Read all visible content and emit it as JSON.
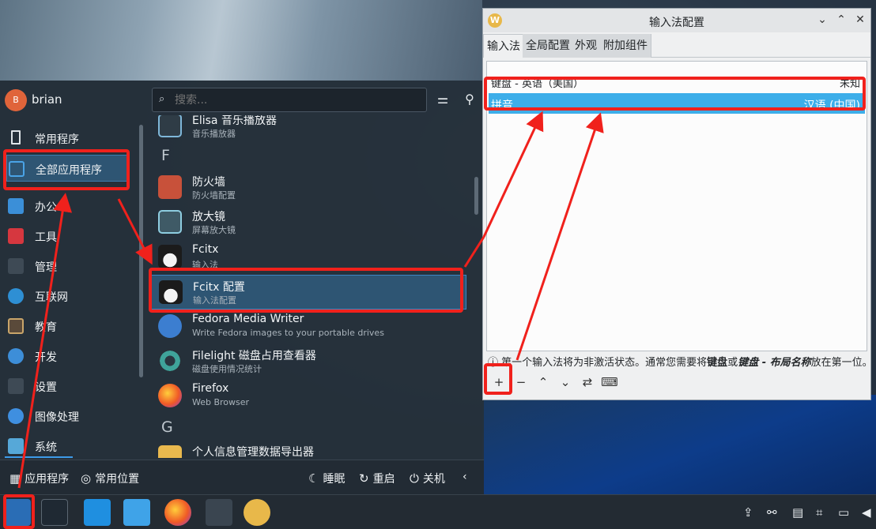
{
  "launcher": {
    "user": {
      "name": "brian",
      "avatar_letter": "B"
    },
    "search": {
      "placeholder": "搜索..."
    },
    "categories": [
      {
        "label": "常用程序",
        "icon": "bookmark-icon"
      },
      {
        "label": "全部应用程序",
        "icon": "grid-icon"
      },
      {
        "label": "办公",
        "icon": "office-icon"
      },
      {
        "label": "工具",
        "icon": "toolbox-icon"
      },
      {
        "label": "管理",
        "icon": "sliders-icon"
      },
      {
        "label": "互联网",
        "icon": "globe-icon"
      },
      {
        "label": "教育",
        "icon": "education-icon"
      },
      {
        "label": "开发",
        "icon": "wrench-icon"
      },
      {
        "label": "设置",
        "icon": "settings-icon"
      },
      {
        "label": "图像处理",
        "icon": "graphics-icon"
      },
      {
        "label": "系统",
        "icon": "system-icon"
      }
    ],
    "app_sections": [
      {
        "letter": "F"
      },
      {
        "letter": "G"
      }
    ],
    "apps": [
      {
        "name": "Elisa 音乐播放器",
        "desc": "音乐播放器",
        "icon": "music-player-icon"
      },
      {
        "name": "防火墙",
        "desc": "防火墙配置",
        "icon": "firewall-icon"
      },
      {
        "name": "放大镜",
        "desc": "屏幕放大镜",
        "icon": "magnifier-icon"
      },
      {
        "name": "Fcitx",
        "desc": "输入法",
        "icon": "penguin-icon"
      },
      {
        "name": "Fcitx 配置",
        "desc": "输入法配置",
        "icon": "penguin-icon"
      },
      {
        "name": "Fedora Media Writer",
        "desc": "Write Fedora images to your portable drives",
        "icon": "fedora-icon"
      },
      {
        "name": "Filelight 磁盘占用查看器",
        "desc": "磁盘使用情况统计",
        "icon": "filelight-icon"
      },
      {
        "name": "Firefox",
        "desc": "Web Browser",
        "icon": "firefox-icon"
      },
      {
        "name": "个人信息管理数据导出器",
        "desc": "",
        "icon": "pim-export-icon"
      }
    ],
    "footer": {
      "apps": "应用程序",
      "places": "常用位置",
      "sleep": "睡眠",
      "restart": "重启",
      "shutdown": "关机"
    }
  },
  "dialog": {
    "title": "输入法配置",
    "tabs": [
      "输入法",
      "全局配置",
      "外观",
      "附加组件"
    ],
    "rows": [
      {
        "name": "键盘 - 英语（美国）",
        "lang": "未知"
      },
      {
        "name": "拼音",
        "lang": "汉语 (中国)"
      }
    ],
    "info_pre": "第一个输入法将为非激活状态。通常您需要将",
    "info_b1": "键盘",
    "info_mid": "或",
    "info_b2": "键盘 - 布局名称",
    "info_post": "放在第一位。"
  },
  "taskbar": {
    "apps": [
      "fedora-launcher-icon",
      "settings-icon",
      "discover-icon",
      "files-icon",
      "firefox-icon",
      "terminal-icon",
      "fcitx-config-icon"
    ]
  },
  "colors": {
    "accent": "#3daee9",
    "annotation": "#f0211c"
  }
}
